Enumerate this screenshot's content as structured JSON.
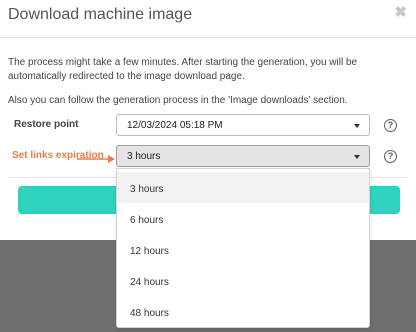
{
  "dialog": {
    "title": "Download machine image",
    "close_icon": "close-icon",
    "info_line1": "The process might take a few minutes. After starting the generation, you will be",
    "info_line2": "automatically redirected to the image download page.",
    "info_line3": "Also you can follow the generation process in the 'Image downloads' section."
  },
  "restore_point": {
    "label": "Restore point",
    "value": "12/03/2024 05:18 PM",
    "help": "?"
  },
  "links_expiration": {
    "annotation": "Set links expiration",
    "annotation_color": "#f07b4a",
    "value": "3 hours",
    "help": "?",
    "options": [
      "3 hours",
      "6 hours",
      "12 hours",
      "24 hours",
      "48 hours"
    ],
    "highlighted_option": "3 hours"
  },
  "colors": {
    "primary_button": "#2fd1bf",
    "overlay": "#6f6f6f"
  }
}
